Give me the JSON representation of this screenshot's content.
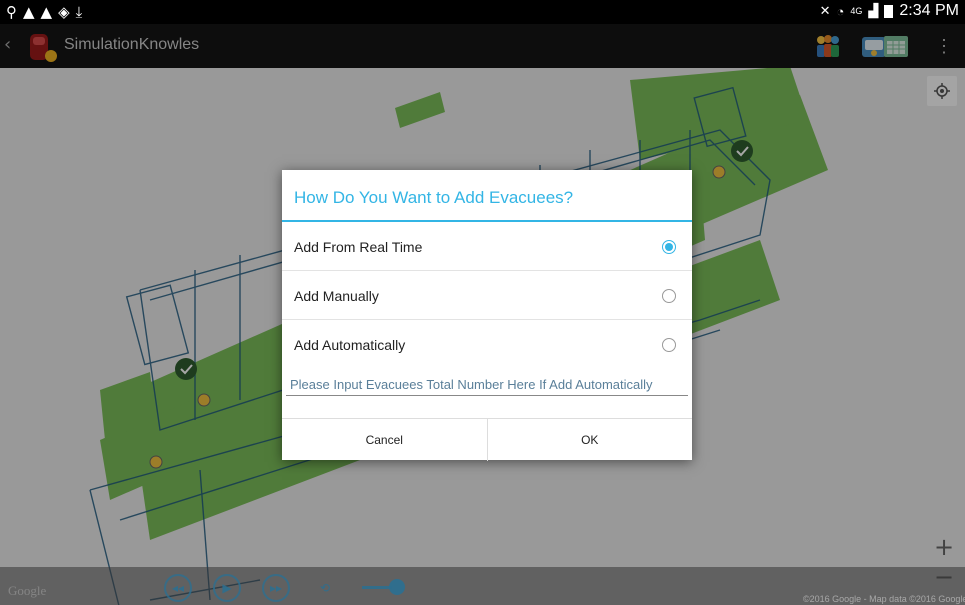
{
  "status_bar": {
    "left_icons": [
      "usb-icon",
      "warning-icon",
      "warning-icon",
      "shield-icon",
      "download-icon"
    ],
    "time": "2:34 PM",
    "network_label": "4G"
  },
  "action_bar": {
    "title": "SimulationKnowles",
    "actions": [
      "people-icon",
      "contact-card-icon",
      "calendar-grid-icon",
      "overflow-menu-icon"
    ]
  },
  "map": {
    "zoom_in": "+",
    "zoom_out": "−",
    "logo": "Google",
    "attribution": "©2016 Google - Map data ©2016 Google",
    "floor_color": "#6fb84a",
    "accent": "#33b5e5"
  },
  "dialog": {
    "title": "How Do You Want to Add Evacuees?",
    "options": [
      {
        "label": "Add From Real Time",
        "checked": true
      },
      {
        "label": "Add Manually",
        "checked": false
      },
      {
        "label": "Add Automatically",
        "checked": false
      }
    ],
    "input_placeholder": "Please Input Evacuees Total Number Here If Add Automatically",
    "cancel_label": "Cancel",
    "ok_label": "OK"
  }
}
